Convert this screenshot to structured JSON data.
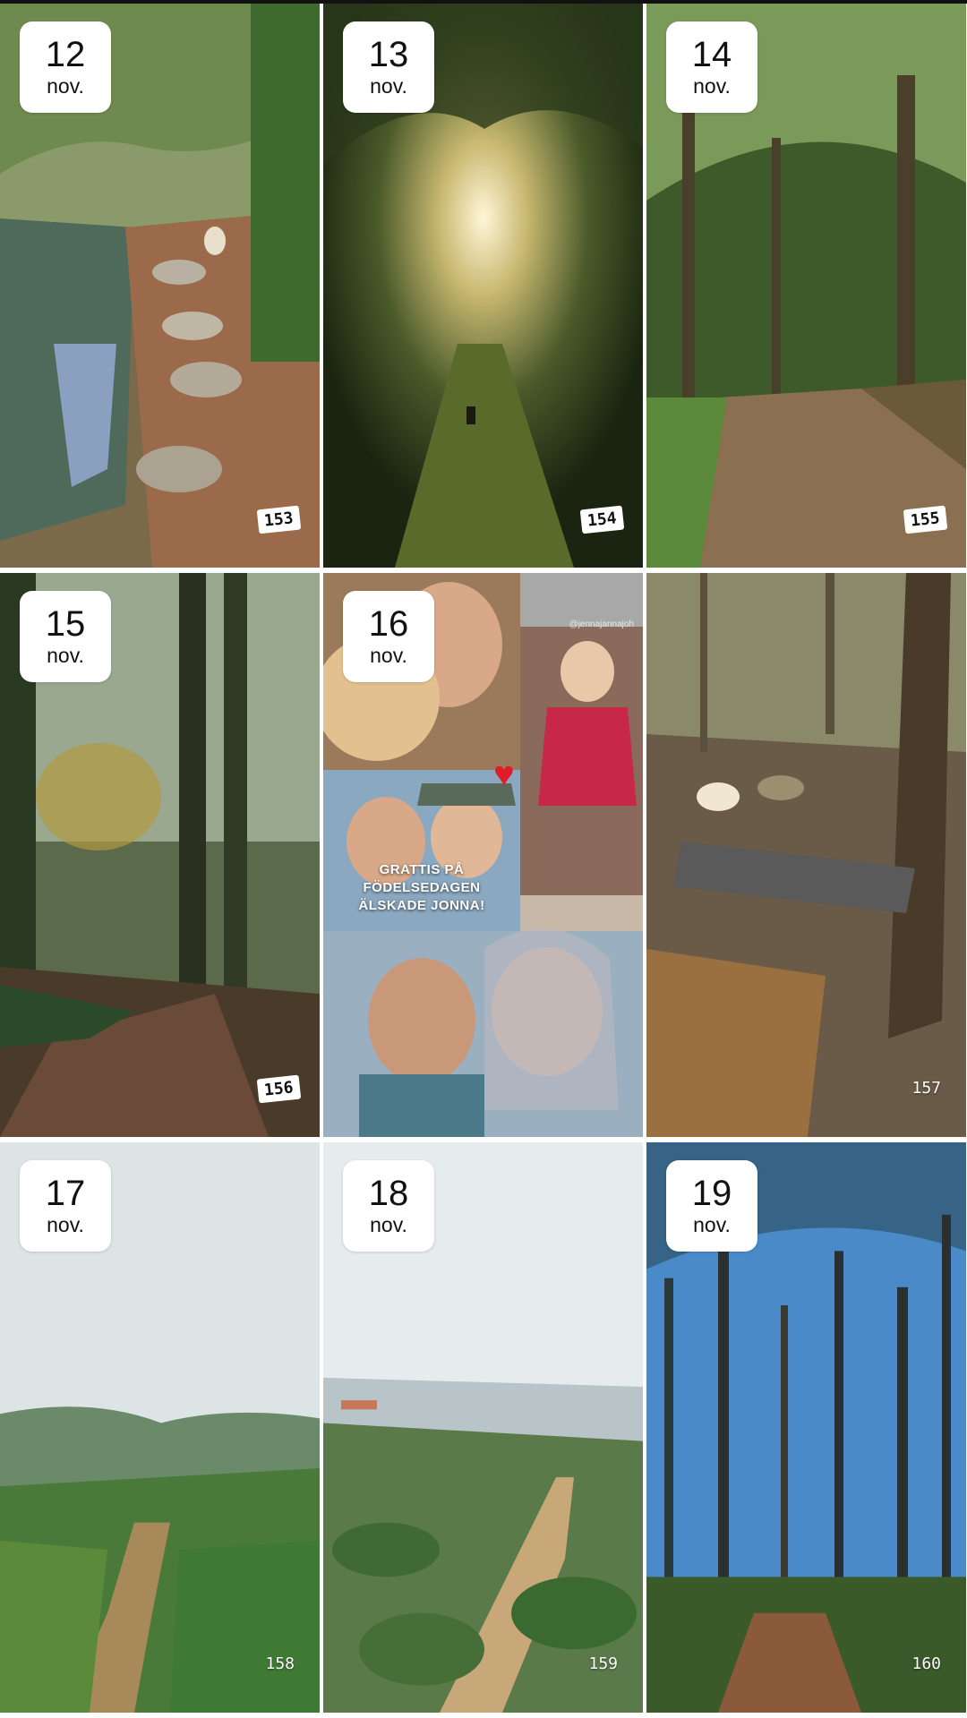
{
  "tiles": [
    {
      "day": "12",
      "month": "nov.",
      "count": "153",
      "count_style": "tag"
    },
    {
      "day": "13",
      "month": "nov.",
      "count": "154",
      "count_style": "tag"
    },
    {
      "day": "14",
      "month": "nov.",
      "count": "155",
      "count_style": "tag"
    },
    {
      "day": "15",
      "month": "nov.",
      "count": "156",
      "count_style": "tag"
    },
    {
      "day": "16",
      "month": "nov.",
      "overlay_line1": "GRATTIS PÅ FÖDELSEDAGEN",
      "overlay_line2": "ÄLSKADE JONNA!",
      "handle": "@jennajannajoh"
    },
    {
      "count": "157",
      "count_style": "plain"
    },
    {
      "day": "17",
      "month": "nov.",
      "count": "158",
      "count_style": "plain"
    },
    {
      "day": "18",
      "month": "nov.",
      "count": "159",
      "count_style": "plain"
    },
    {
      "day": "19",
      "month": "nov.",
      "count": "160",
      "count_style": "plain"
    }
  ],
  "icons": {
    "heart": "heart-icon"
  },
  "colors": {
    "badge_bg": "#ffffff",
    "heart": "#e01b2a"
  }
}
